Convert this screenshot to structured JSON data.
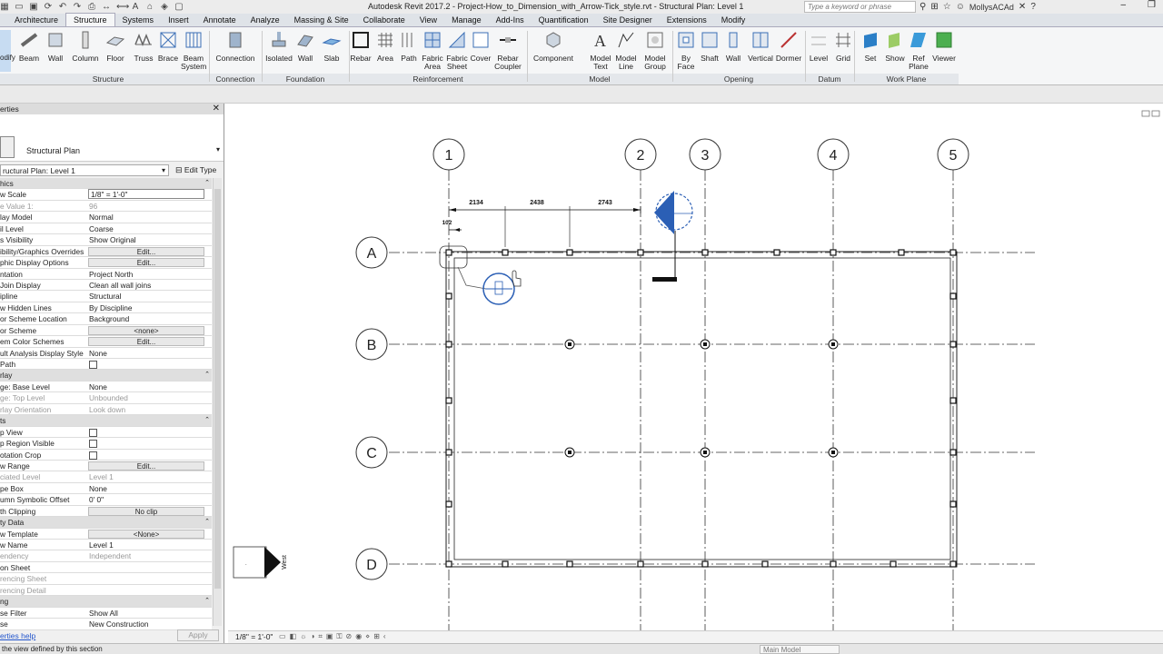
{
  "app": {
    "title": "Autodesk Revit 2017.2 -    Project-How_to_Dimension_with_Arrow-Tick_style.rvt - Structural Plan: Level 1",
    "search_placeholder": "Type a keyword or phrase",
    "user": "MollysACAd"
  },
  "tabs": [
    "Architecture",
    "Structure",
    "Systems",
    "Insert",
    "Annotate",
    "Analyze",
    "Massing & Site",
    "Collaborate",
    "View",
    "Manage",
    "Add-Ins",
    "Quantification",
    "Site Designer",
    "Extensions",
    "Modify"
  ],
  "active_tab": "Structure",
  "ribbon": {
    "modify": "odify",
    "structure_tools": [
      {
        "label": "Beam",
        "icon": "beam-icon"
      },
      {
        "label": "Wall",
        "icon": "wall-icon"
      },
      {
        "label": "Column",
        "icon": "column-icon"
      },
      {
        "label": "Floor",
        "icon": "floor-icon"
      },
      {
        "label": "Truss",
        "icon": "truss-icon"
      },
      {
        "label": "Brace",
        "icon": "brace-icon"
      },
      {
        "label": "Beam\nSystem",
        "icon": "beam-system-icon"
      }
    ],
    "connection_tool": {
      "label": "Connection",
      "icon": "connection-icon"
    },
    "foundation_tools": [
      {
        "label": "Isolated",
        "icon": "isolated-icon"
      },
      {
        "label": "Wall",
        "icon": "wall-foundation-icon"
      },
      {
        "label": "Slab",
        "icon": "slab-icon"
      }
    ],
    "reinforcement_tools": [
      {
        "label": "Rebar",
        "icon": "rebar-icon"
      },
      {
        "label": "Area",
        "icon": "area-icon"
      },
      {
        "label": "Path",
        "icon": "path-icon"
      },
      {
        "label": "Fabric\nArea",
        "icon": "fabric-area-icon"
      },
      {
        "label": "Fabric\nSheet",
        "icon": "fabric-sheet-icon"
      },
      {
        "label": "Cover",
        "icon": "cover-icon"
      },
      {
        "label": "Rebar\nCoupler",
        "icon": "rebar-coupler-icon"
      }
    ],
    "component_tool": {
      "label": "Component",
      "icon": "component-icon"
    },
    "model_tools": [
      {
        "label": "Model\nText",
        "icon": "model-text-icon"
      },
      {
        "label": "Model\nLine",
        "icon": "model-line-icon"
      },
      {
        "label": "Model\nGroup",
        "icon": "model-group-icon"
      }
    ],
    "opening_tools": [
      {
        "label": "By\nFace",
        "icon": "by-face-icon"
      },
      {
        "label": "Shaft",
        "icon": "shaft-icon"
      },
      {
        "label": "Wall",
        "icon": "wall-opening-icon"
      },
      {
        "label": "Vertical",
        "icon": "vertical-icon"
      },
      {
        "label": "Dormer",
        "icon": "dormer-icon"
      }
    ],
    "datum_tools": [
      {
        "label": "Level",
        "icon": "level-icon"
      },
      {
        "label": "Grid",
        "icon": "grid-icon"
      }
    ],
    "workplane_tools": [
      {
        "label": "Set",
        "icon": "set-icon"
      },
      {
        "label": "Show",
        "icon": "show-icon"
      },
      {
        "label": "Ref\nPlane",
        "icon": "ref-plane-icon"
      },
      {
        "label": "Viewer",
        "icon": "viewer-icon"
      }
    ],
    "panels": [
      "Structure",
      "Connection",
      "Foundation",
      "Reinforcement",
      "Model",
      "Opening",
      "Datum",
      "Work Plane"
    ]
  },
  "properties": {
    "header": "erties",
    "type_name": "Structural Plan",
    "instance": "ructural Plan: Level 1",
    "edit_type": "Edit Type",
    "rows": [
      {
        "k": "hics",
        "v": "",
        "kind": "group"
      },
      {
        "k": "w Scale",
        "v": "1/8\" = 1'-0\"",
        "kind": "input"
      },
      {
        "k": "e Value   1:",
        "v": "96",
        "kind": "grey"
      },
      {
        "k": "lay Model",
        "v": "Normal"
      },
      {
        "k": "il Level",
        "v": "Coarse"
      },
      {
        "k": "s Visibility",
        "v": "Show Original"
      },
      {
        "k": "ibility/Graphics Overrides",
        "v": "Edit...",
        "kind": "button"
      },
      {
        "k": "phic Display Options",
        "v": "Edit...",
        "kind": "button"
      },
      {
        "k": "ntation",
        "v": "Project North"
      },
      {
        "k": " Join Display",
        "v": "Clean all wall joins"
      },
      {
        "k": "ipline",
        "v": "Structural"
      },
      {
        "k": "w Hidden Lines",
        "v": "By Discipline"
      },
      {
        "k": "or Scheme Location",
        "v": "Background"
      },
      {
        "k": "or Scheme",
        "v": "<none>",
        "kind": "button"
      },
      {
        "k": "em Color Schemes",
        "v": "Edit...",
        "kind": "button"
      },
      {
        "k": "ult Analysis Display Style",
        "v": "None"
      },
      {
        "k": " Path",
        "v": "",
        "kind": "check"
      },
      {
        "k": "rlay",
        "v": "",
        "kind": "group"
      },
      {
        "k": "ge: Base Level",
        "v": "None"
      },
      {
        "k": "ge: Top Level",
        "v": "Unbounded",
        "kind": "grey"
      },
      {
        "k": "rlay Orientation",
        "v": "Look down",
        "kind": "grey"
      },
      {
        "k": "ts",
        "v": "",
        "kind": "group"
      },
      {
        "k": "p View",
        "v": "",
        "kind": "check"
      },
      {
        "k": "p Region Visible",
        "v": "",
        "kind": "check"
      },
      {
        "k": "otation Crop",
        "v": "",
        "kind": "check"
      },
      {
        "k": "w Range",
        "v": "Edit...",
        "kind": "button"
      },
      {
        "k": "ciated Level",
        "v": "Level 1",
        "kind": "grey"
      },
      {
        "k": "pe Box",
        "v": "None"
      },
      {
        "k": "umn Symbolic Offset",
        "v": "0'  0\""
      },
      {
        "k": "th Clipping",
        "v": "No clip",
        "kind": "button"
      },
      {
        "k": "ty Data",
        "v": "",
        "kind": "group"
      },
      {
        "k": "w Template",
        "v": "<None>",
        "kind": "button"
      },
      {
        "k": "w Name",
        "v": "Level 1"
      },
      {
        "k": "endency",
        "v": "Independent",
        "kind": "grey"
      },
      {
        "k": " on Sheet",
        "v": ""
      },
      {
        "k": "rencing Sheet",
        "v": "",
        "kind": "grey"
      },
      {
        "k": "rencing Detail",
        "v": "",
        "kind": "grey"
      },
      {
        "k": "ng",
        "v": "",
        "kind": "group"
      },
      {
        "k": "se Filter",
        "v": "Show All"
      },
      {
        "k": "se",
        "v": "New Construction"
      }
    ],
    "help": "erties help",
    "apply": "Apply"
  },
  "plan": {
    "grid_columns": [
      "1",
      "2",
      "3",
      "4",
      "5"
    ],
    "grid_rows": [
      "A",
      "B",
      "C",
      "D"
    ],
    "dimensions": [
      "2134",
      "2438",
      "2743",
      "102"
    ],
    "elevation_label": "West"
  },
  "viewbar": {
    "scale": "1/8\" = 1'-0\""
  },
  "status": {
    "text": "the view defined by this section",
    "workset": "Main Model"
  }
}
